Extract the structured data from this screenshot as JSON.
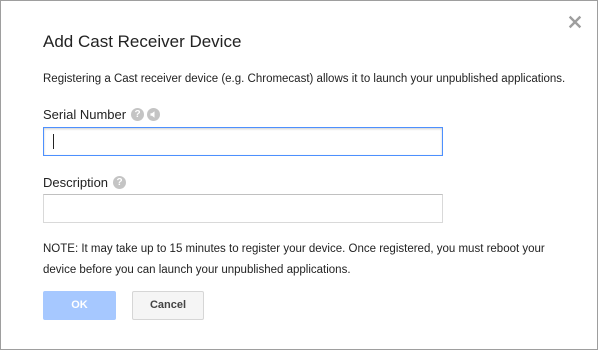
{
  "dialog": {
    "title": "Add Cast Receiver Device",
    "intro": "Registering a Cast receiver device (e.g. Chromecast) allows it to launch your unpublished applications.",
    "close_icon": "close-icon"
  },
  "form": {
    "serial": {
      "label": "Serial Number",
      "value": "",
      "help_icon": "help-icon",
      "audio_icon": "audio-icon"
    },
    "description": {
      "label": "Description",
      "value": "",
      "help_icon": "help-icon"
    }
  },
  "note": "NOTE: It may take up to 15 minutes to register your device. Once registered, you must reboot your device before you can launch your unpublished applications.",
  "buttons": {
    "ok": "OK",
    "cancel": "Cancel"
  },
  "colors": {
    "ok_disabled_bg": "#a6c8ff",
    "focus_border": "#4d90fe",
    "icon_gray": "#c4c4c4"
  },
  "icons": {
    "help_glyph": "?"
  }
}
